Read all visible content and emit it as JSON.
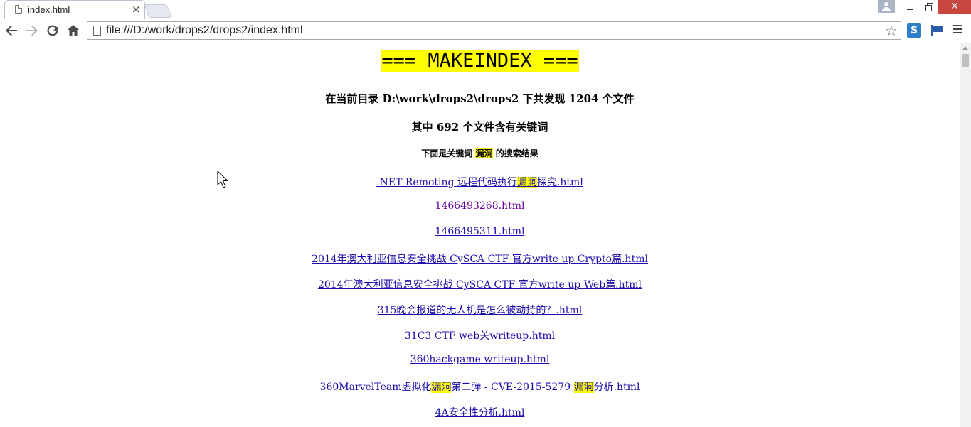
{
  "browser": {
    "tab_title": "index.html",
    "url": "file:///D:/work/drops2/drops2/index.html",
    "extension_label": "S"
  },
  "page": {
    "title": "=== MAKEINDEX ===",
    "summary_line": "在当前目录 D:\\work\\drops2\\drops2 下共发现 1204 个文件",
    "match_line": "其中 692 个文件含有关键词",
    "result_prefix": "下面是关键词",
    "keyword": "漏洞",
    "result_suffix": "的搜索结果",
    "links": [
      {
        "parts": [
          ".NET Remoting 远程代码执行",
          "漏洞",
          "探究.html"
        ]
      },
      {
        "parts": [
          "1466493268.html"
        ]
      },
      {
        "parts": [
          "1466495311.html"
        ]
      },
      {
        "parts": [
          "2014年澳大利亚信息安全挑战 CySCA CTF 官方write up Crypto篇.html"
        ]
      },
      {
        "parts": [
          "2014年澳大利亚信息安全挑战 CySCA CTF 官方write up Web篇.html"
        ]
      },
      {
        "parts": [
          "315晚会报道的无人机是怎么被劫持的？.html"
        ]
      },
      {
        "parts": [
          "31C3 CTF web关writeup.html"
        ]
      },
      {
        "parts": [
          "360hackgame writeup.html"
        ]
      },
      {
        "parts": [
          "360MarvelTeam虚拟化",
          "漏洞",
          "第二弹 - CVE-2015-5279 ",
          "漏洞",
          "分析.html"
        ]
      },
      {
        "parts": [
          "4A安全性分析.html"
        ]
      }
    ]
  },
  "colors": {
    "highlight": "#ffff00",
    "link": "#1a0dab",
    "close_button": "#c7463e"
  }
}
